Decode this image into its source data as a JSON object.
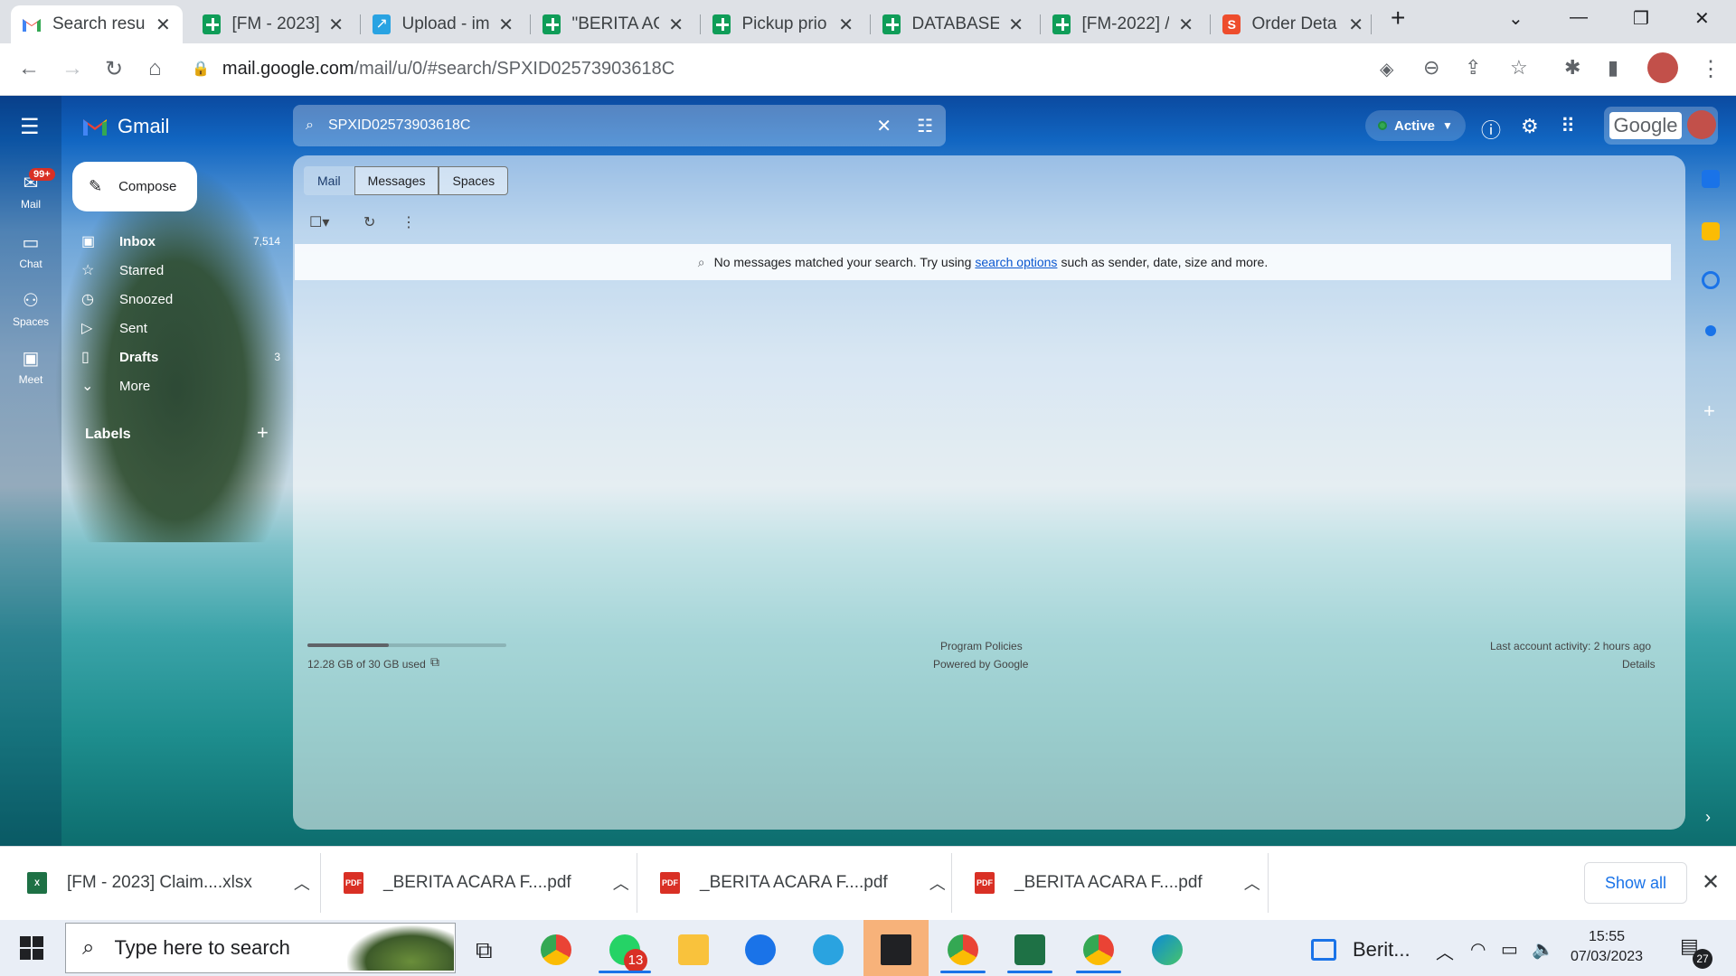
{
  "browser": {
    "tabs": [
      {
        "title": "Search resu",
        "icon": "gmail-icon",
        "active": true
      },
      {
        "title": "[FM - 2023]",
        "icon": "sheets-icon"
      },
      {
        "title": "Upload - im",
        "icon": "upload-icon"
      },
      {
        "title": "\"BERITA AC",
        "icon": "sheets-icon"
      },
      {
        "title": "Pickup prio",
        "icon": "sheets-icon"
      },
      {
        "title": "DATABASE",
        "icon": "sheets-icon"
      },
      {
        "title": "[FM-2022] /",
        "icon": "sheets-icon"
      },
      {
        "title": "Order Deta",
        "icon": "shopee-icon"
      }
    ],
    "url_host": "mail.google.com",
    "url_path": "/mail/u/0/#search/SPXID02573903618C"
  },
  "gmail": {
    "app_name": "Gmail",
    "search_value": "SPXID02573903618C",
    "compose_label": "Compose",
    "rail": [
      {
        "label": "Mail",
        "badge": "99+"
      },
      {
        "label": "Chat"
      },
      {
        "label": "Spaces"
      },
      {
        "label": "Meet"
      }
    ],
    "nav": [
      {
        "label": "Inbox",
        "count": "7,514",
        "bold": true
      },
      {
        "label": "Starred",
        "count": ""
      },
      {
        "label": "Snoozed",
        "count": ""
      },
      {
        "label": "Sent",
        "count": ""
      },
      {
        "label": "Drafts",
        "count": "3",
        "bold": true
      },
      {
        "label": "More",
        "count": ""
      }
    ],
    "labels_heading": "Labels",
    "status": "Active",
    "google_word": "Google",
    "segments": [
      "Mail",
      "Messages",
      "Spaces"
    ],
    "no_messages_before": "No messages matched your search. Try using",
    "no_messages_link": "search options",
    "no_messages_after": "such as sender, date, size and more.",
    "storage": {
      "text": "12.28 GB of 30 GB used",
      "fraction": 0.41
    },
    "footer_center": [
      "Program Policies",
      "Powered by Google"
    ],
    "footer_right": [
      "Last account activity: 2 hours ago",
      "Details"
    ]
  },
  "downloads": {
    "items": [
      {
        "name": "[FM - 2023] Claim....xlsx",
        "type": "xlsx"
      },
      {
        "name": "_BERITA ACARA F....pdf",
        "type": "pdf"
      },
      {
        "name": "_BERITA ACARA F....pdf",
        "type": "pdf"
      },
      {
        "name": "_BERITA ACARA F....pdf",
        "type": "pdf"
      }
    ],
    "show_all": "Show all"
  },
  "taskbar": {
    "search_placeholder": "Type here to search",
    "whatsapp_badge": "13",
    "widget_label": "Berit...",
    "time": "15:55",
    "date": "07/03/2023",
    "notifications": "27"
  },
  "colors": {
    "accent": "#1a73e8",
    "sheets": "#0f9d58",
    "pdf": "#d93025",
    "excel": "#1e7145"
  }
}
